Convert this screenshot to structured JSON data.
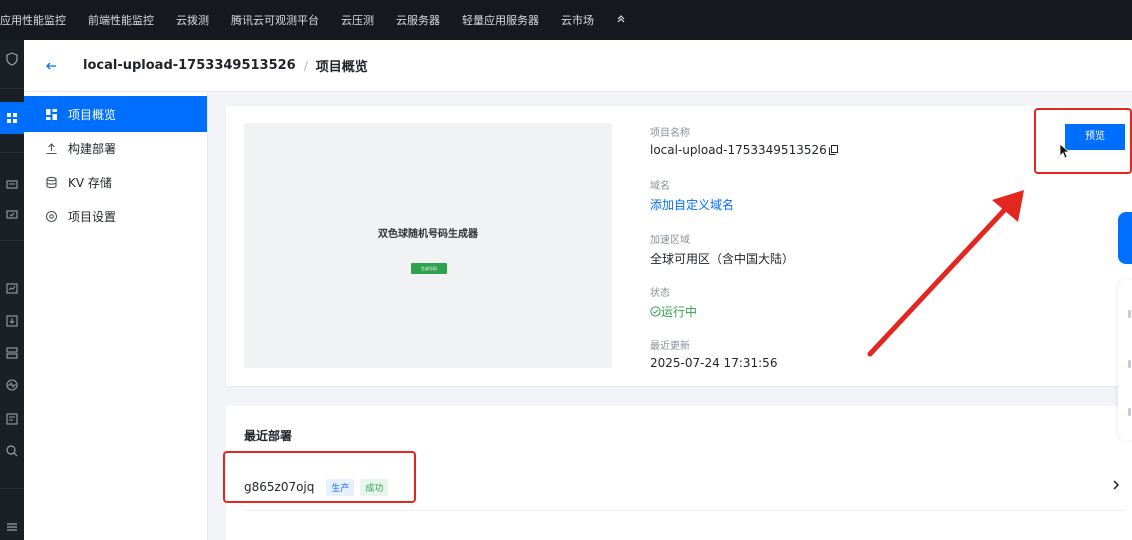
{
  "topnav": {
    "items": [
      "应用性能监控",
      "前端性能监控",
      "云拨测",
      "腾讯云可观测平台",
      "云压测",
      "云服务器",
      "轻量应用服务器",
      "云市场"
    ]
  },
  "header": {
    "project": "local-upload-1753349513526",
    "separator": "/",
    "page": "项目概览"
  },
  "sidebar": {
    "items": [
      {
        "label": "项目概览",
        "icon": "overview-icon",
        "active": true
      },
      {
        "label": "构建部署",
        "icon": "upload-icon"
      },
      {
        "label": "KV 存储",
        "icon": "database-icon"
      },
      {
        "label": "项目设置",
        "icon": "settings-icon"
      }
    ]
  },
  "preview": {
    "title": "双色球随机号码生成器",
    "button": "生成号码"
  },
  "info": {
    "name_label": "项目名称",
    "name_value": "local-upload-1753349513526",
    "domain_label": "域名",
    "domain_link": "添加自定义域名",
    "region_label": "加速区域",
    "region_value": "全球可用区（含中国大陆）",
    "status_label": "状态",
    "status_value": "运行中",
    "updated_label": "最近更新",
    "updated_value": "2025-07-24 17:31:56"
  },
  "actions": {
    "preview_label": "预览"
  },
  "deployments": {
    "title": "最近部署",
    "rows": [
      {
        "id": "g865z07ojq",
        "env": "生产",
        "status": "成功"
      }
    ]
  },
  "colors": {
    "accent": "#006eff",
    "success": "#2fa24d",
    "annotation": "#e3261f"
  }
}
